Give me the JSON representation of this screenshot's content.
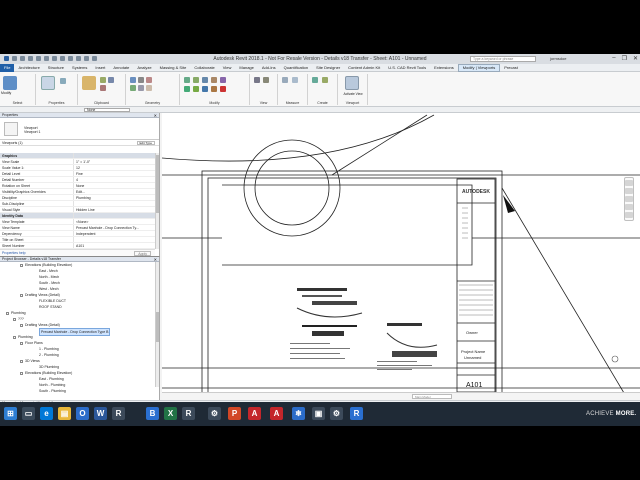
{
  "titlebar": {
    "title": "Autodesk Revit 2018.1 - Not For Resale Version -   Details v18 Transfer - Sheet: A101 - Unnamed",
    "search_placeholder": "Type a keyword or phrase",
    "user": "jormsdoe"
  },
  "menu": [
    "File",
    "Architecture",
    "Structure",
    "Systems",
    "Insert",
    "Annotate",
    "Analyze",
    "Massing & Site",
    "Collaborate",
    "View",
    "Manage",
    "Add-Ins",
    "Quantification",
    "Site Designer",
    "Content Admin Kit",
    "U.S. CAD Revit Tools",
    "Extensions",
    "Modify | Viewports",
    "Precast"
  ],
  "ribbon": {
    "groups": [
      "Select",
      "Properties",
      "Clipboard",
      "Geometry",
      "Modify",
      "View",
      "Measure",
      "Create",
      "Viewport"
    ],
    "modify_label": "Modify",
    "activate_view_label": "Activate View"
  },
  "typebar": {
    "selector": "None"
  },
  "properties": {
    "header": "Properties",
    "type_line1": "Viewport",
    "type_line2": "Viewport 1",
    "filter": "Viewports (1)",
    "edit_type": "Edit Type",
    "rows": [
      {
        "group": true,
        "k": "Graphics",
        "v": ""
      },
      {
        "k": "View Scale",
        "v": "1\" = 1'-0\""
      },
      {
        "k": "Scale Value    1:",
        "v": "12"
      },
      {
        "k": "Detail Level",
        "v": "Fine"
      },
      {
        "k": "Detail Number",
        "v": "4"
      },
      {
        "k": "Rotation on Sheet",
        "v": "None"
      },
      {
        "k": "Visibility/Graphics Overrides",
        "v": "Edit..."
      },
      {
        "k": "Discipline",
        "v": "Plumbing"
      },
      {
        "k": "Sub-Discipline",
        "v": ""
      },
      {
        "k": "Visual Style",
        "v": "Hidden Line"
      },
      {
        "group": true,
        "k": "Identity Data",
        "v": ""
      },
      {
        "k": "View Template",
        "v": "<None>"
      },
      {
        "k": "View Name",
        "v": "Precast Manhole - Drop Connection Ty..."
      },
      {
        "k": "Dependency",
        "v": "Independent"
      },
      {
        "k": "Title on Sheet",
        "v": ""
      },
      {
        "k": "Sheet Number",
        "v": "A101"
      }
    ],
    "help_link": "Properties help",
    "apply": "Apply"
  },
  "browser": {
    "header": "Project Browser - Details v18 Transfer",
    "items": [
      {
        "indent": 3,
        "text": "Elevations (Building Elevation)",
        "tog": "-"
      },
      {
        "indent": 5,
        "text": "East - Mech",
        "tog": ""
      },
      {
        "indent": 5,
        "text": "North - Mech",
        "tog": ""
      },
      {
        "indent": 5,
        "text": "South - Mech",
        "tog": ""
      },
      {
        "indent": 5,
        "text": "West - Mech",
        "tog": ""
      },
      {
        "indent": 3,
        "text": "Drafting Views (Detail)",
        "tog": "-"
      },
      {
        "indent": 5,
        "text": "FLEXIBLE DUCT",
        "tog": ""
      },
      {
        "indent": 5,
        "text": "ROOF STAND",
        "tog": ""
      },
      {
        "indent": 1,
        "text": "Plumbing",
        "tog": "-"
      },
      {
        "indent": 2,
        "text": "???",
        "tog": "-"
      },
      {
        "indent": 3,
        "text": "Drafting Views (Detail)",
        "tog": "-"
      },
      {
        "indent": 5,
        "text": "Precast Manhole - Drop Connection Type B",
        "tog": "",
        "sel": true
      },
      {
        "indent": 2,
        "text": "Plumbing",
        "tog": "-"
      },
      {
        "indent": 3,
        "text": "Floor Plans",
        "tog": "-"
      },
      {
        "indent": 5,
        "text": "1 - Plumbing",
        "tog": ""
      },
      {
        "indent": 5,
        "text": "2 - Plumbing",
        "tog": ""
      },
      {
        "indent": 3,
        "text": "3D Views",
        "tog": "-"
      },
      {
        "indent": 5,
        "text": "3D Plumbing",
        "tog": ""
      },
      {
        "indent": 3,
        "text": "Elevations (Building Elevation)",
        "tog": "-"
      },
      {
        "indent": 5,
        "text": "East - Plumbing",
        "tog": ""
      },
      {
        "indent": 5,
        "text": "North - Plumbing",
        "tog": ""
      },
      {
        "indent": 5,
        "text": "South - Plumbing",
        "tog": ""
      }
    ]
  },
  "sheet": {
    "brand": "AUTODESK",
    "owner": "Owner",
    "project_name": "Project Name",
    "unnamed": "Unnamed",
    "sheet_number": "A101"
  },
  "statusbar": {
    "text": "Viewports : Viewport : Viewport 1"
  },
  "viewbar": {
    "model": "Main Model"
  },
  "watermark": {
    "a": "ACHIEVE",
    "b": "MORE."
  }
}
